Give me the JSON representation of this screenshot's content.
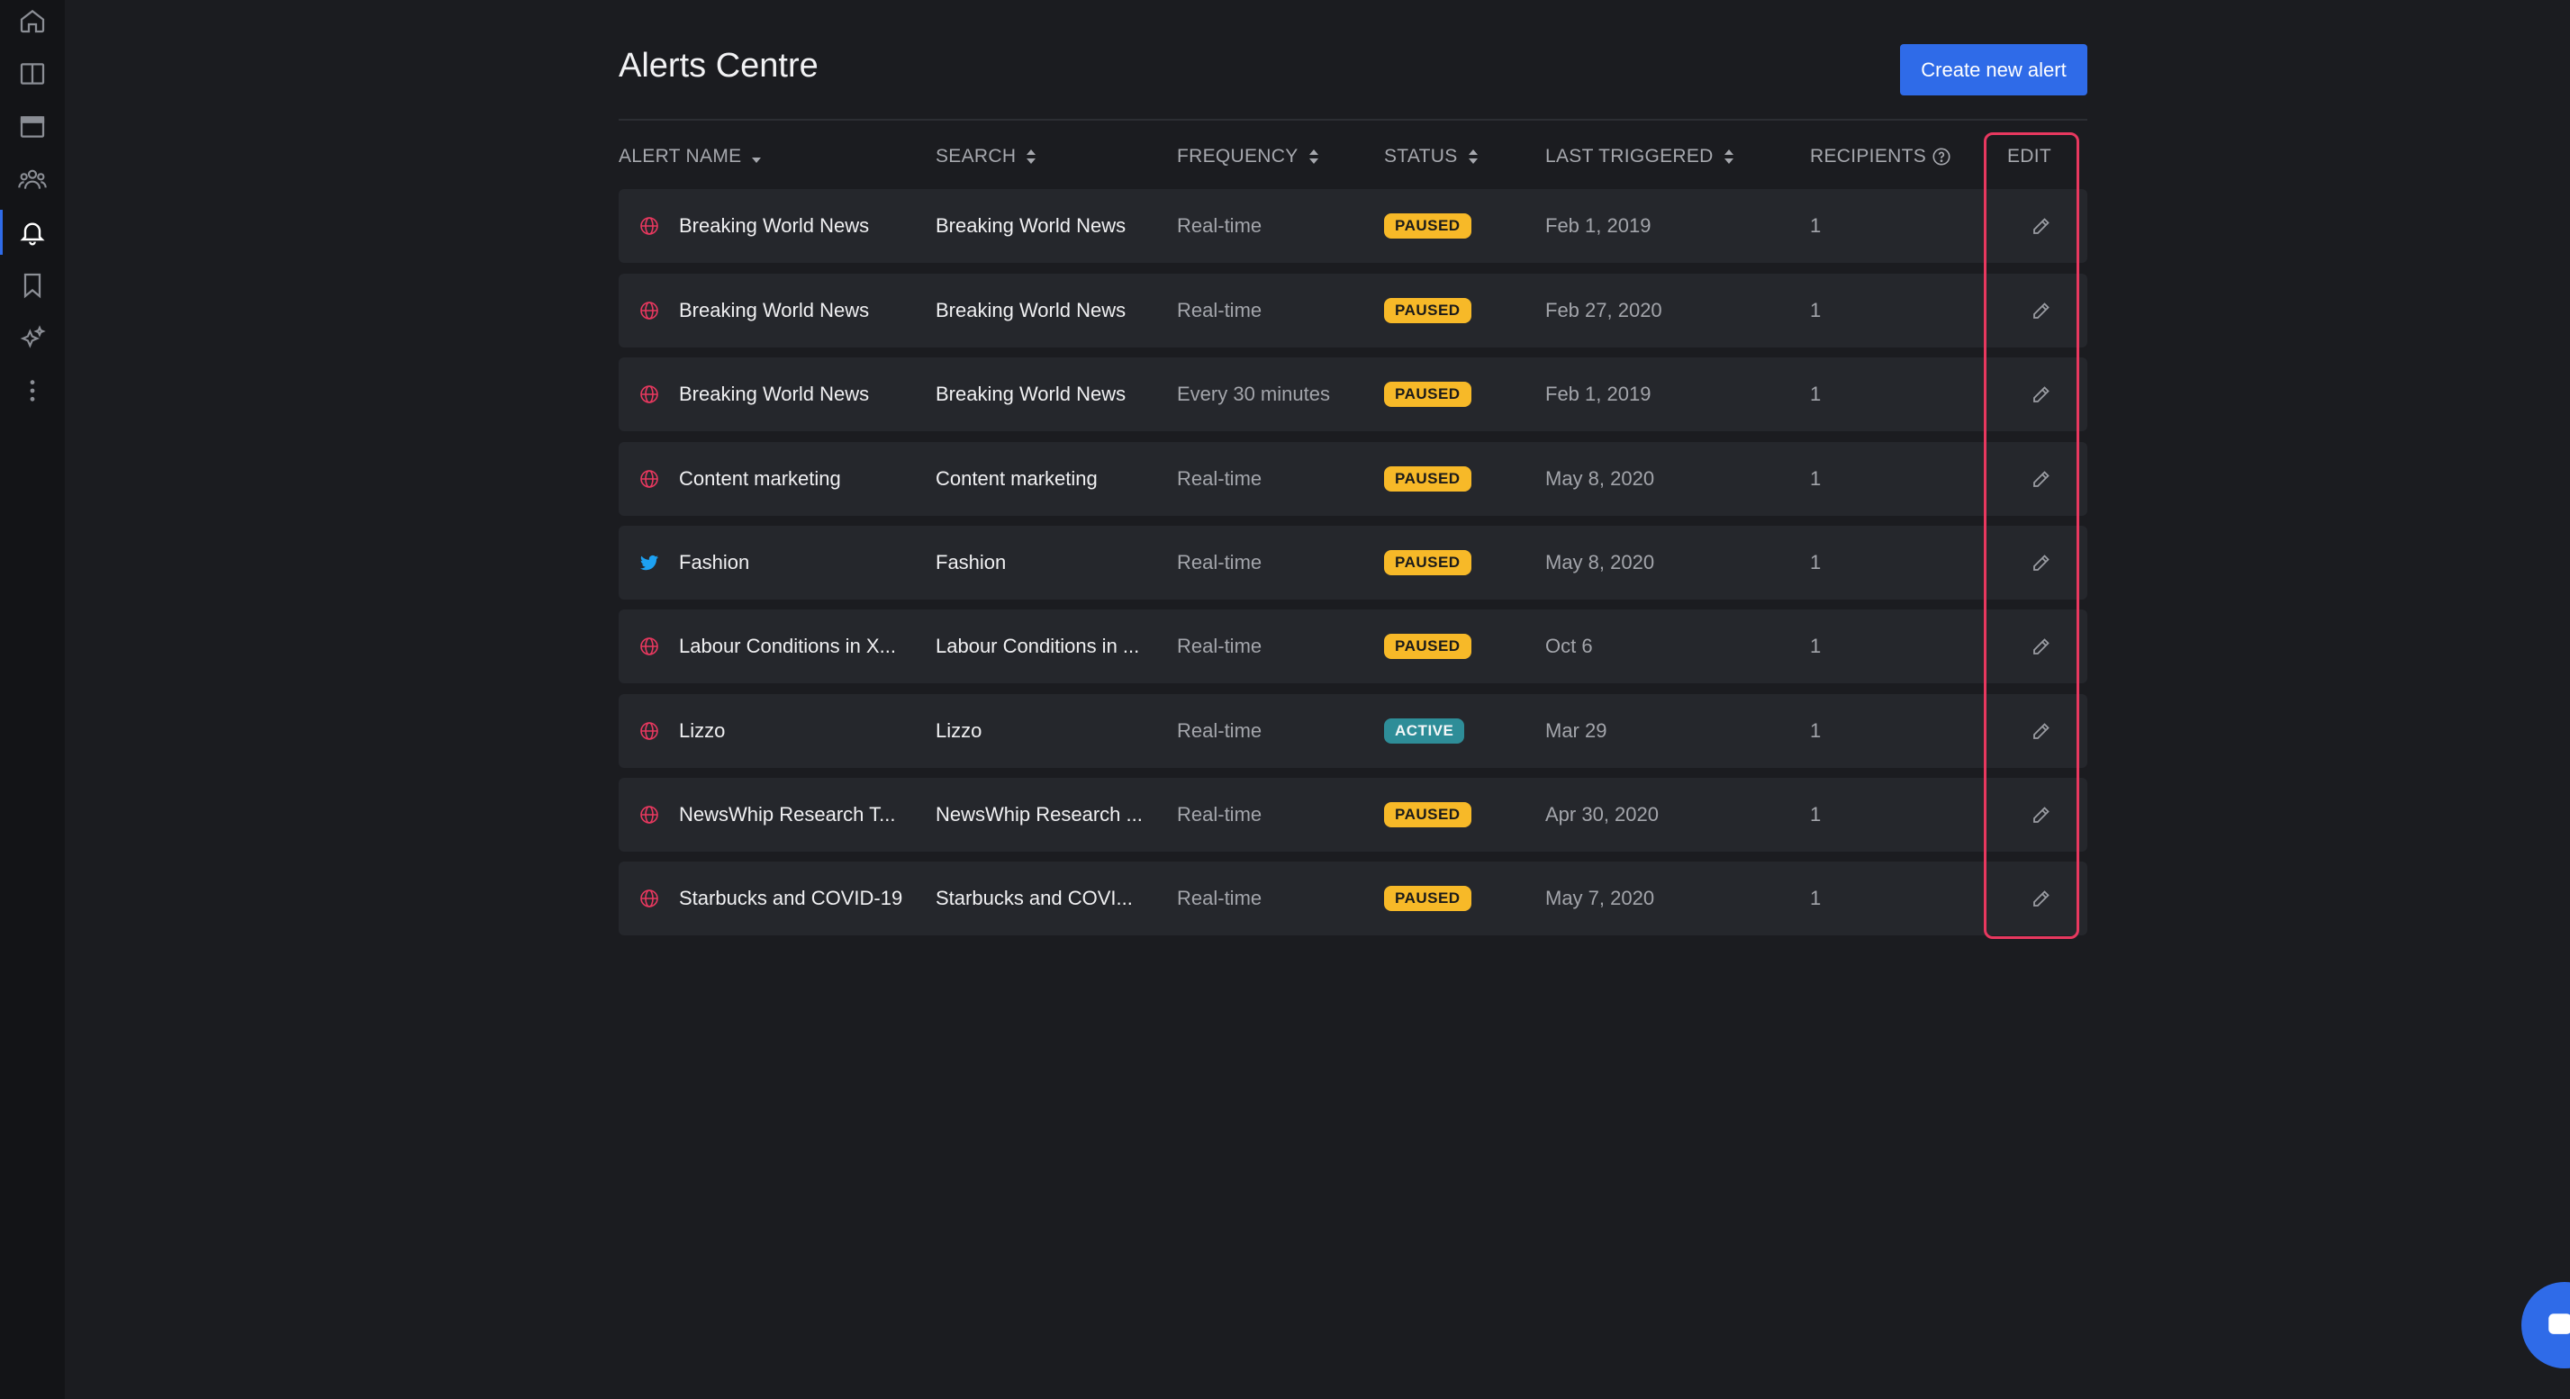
{
  "sidebar": {
    "items": [
      {
        "icon": "home-icon",
        "active": false
      },
      {
        "icon": "columns-icon",
        "active": false
      },
      {
        "icon": "window-icon",
        "active": false
      },
      {
        "icon": "users-icon",
        "active": false
      },
      {
        "icon": "bell-icon",
        "active": true
      },
      {
        "icon": "bookmark-icon",
        "active": false
      },
      {
        "icon": "sparkle-icon",
        "active": false
      },
      {
        "icon": "more-vertical-icon",
        "active": false
      }
    ]
  },
  "page": {
    "title": "Alerts Centre",
    "create_button_label": "Create new alert"
  },
  "table": {
    "columns": {
      "alert_name": "ALERT NAME",
      "search": "SEARCH",
      "frequency": "FREQUENCY",
      "status": "STATUS",
      "last_triggered": "LAST TRIGGERED",
      "recipients": "RECIPIENTS",
      "edit": "EDIT"
    },
    "rows": [
      {
        "source": "web",
        "name": "Breaking World News",
        "search": "Breaking World News",
        "frequency": "Real-time",
        "status": "PAUSED",
        "last_triggered": "Feb 1, 2019",
        "recipients": "1"
      },
      {
        "source": "web",
        "name": "Breaking World News",
        "search": "Breaking World News",
        "frequency": "Real-time",
        "status": "PAUSED",
        "last_triggered": "Feb 27, 2020",
        "recipients": "1"
      },
      {
        "source": "web",
        "name": "Breaking World News",
        "search": "Breaking World News",
        "frequency": "Every 30 minutes",
        "status": "PAUSED",
        "last_triggered": "Feb 1, 2019",
        "recipients": "1"
      },
      {
        "source": "web",
        "name": "Content marketing",
        "search": "Content marketing",
        "frequency": "Real-time",
        "status": "PAUSED",
        "last_triggered": "May 8, 2020",
        "recipients": "1"
      },
      {
        "source": "twitter",
        "name": "Fashion",
        "search": "Fashion",
        "frequency": "Real-time",
        "status": "PAUSED",
        "last_triggered": "May 8, 2020",
        "recipients": "1"
      },
      {
        "source": "web",
        "name": "Labour Conditions in X...",
        "search": "Labour Conditions in ...",
        "frequency": "Real-time",
        "status": "PAUSED",
        "last_triggered": "Oct 6",
        "recipients": "1"
      },
      {
        "source": "web",
        "name": "Lizzo",
        "search": "Lizzo",
        "frequency": "Real-time",
        "status": "ACTIVE",
        "last_triggered": "Mar 29",
        "recipients": "1"
      },
      {
        "source": "web",
        "name": "NewsWhip Research T...",
        "search": "NewsWhip Research ...",
        "frequency": "Real-time",
        "status": "PAUSED",
        "last_triggered": "Apr 30, 2020",
        "recipients": "1"
      },
      {
        "source": "web",
        "name": "Starbucks and COVID-19",
        "search": "Starbucks and COVI...",
        "frequency": "Real-time",
        "status": "PAUSED",
        "last_triggered": "May 7, 2020",
        "recipients": "1"
      }
    ]
  },
  "colors": {
    "background": "#1b1c20",
    "sidebar": "#131417",
    "row": "#25272c",
    "accent": "#2f6be8",
    "paused": "#f7b928",
    "active": "#2e8d98",
    "highlight": "#e8385f",
    "web_source": "#e8385f",
    "twitter_source": "#1da1f2"
  }
}
